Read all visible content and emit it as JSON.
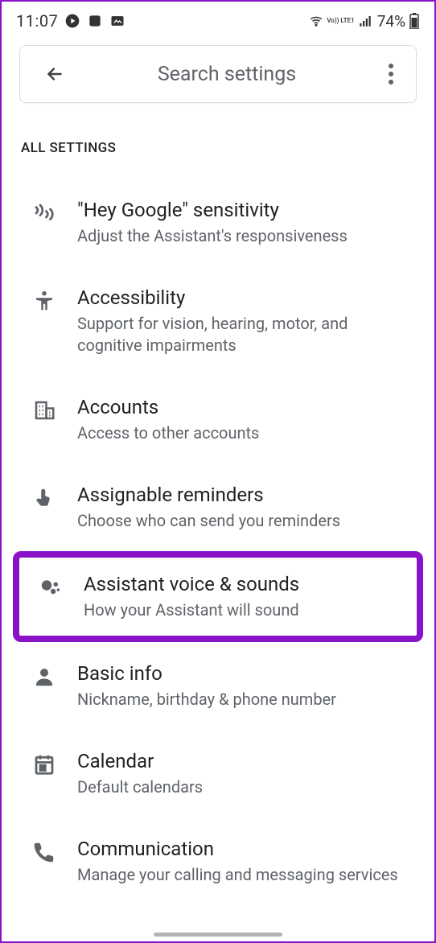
{
  "status": {
    "time": "11:07",
    "battery": "74%",
    "net_label": "Vo)) LTE1"
  },
  "search": {
    "placeholder": "Search settings"
  },
  "section_header": "ALL SETTINGS",
  "items": [
    {
      "title": "\"Hey Google\" sensitivity",
      "subtitle": "Adjust the Assistant's responsiveness"
    },
    {
      "title": "Accessibility",
      "subtitle": "Support for vision, hearing, motor, and cognitive impairments"
    },
    {
      "title": "Accounts",
      "subtitle": "Access to other accounts"
    },
    {
      "title": "Assignable reminders",
      "subtitle": "Choose who can send you reminders"
    },
    {
      "title": "Assistant voice & sounds",
      "subtitle": "How your Assistant will sound"
    },
    {
      "title": "Basic info",
      "subtitle": "Nickname, birthday & phone number"
    },
    {
      "title": "Calendar",
      "subtitle": "Default calendars"
    },
    {
      "title": "Communication",
      "subtitle": "Manage your calling and messaging services"
    }
  ],
  "highlighted_index": 4
}
